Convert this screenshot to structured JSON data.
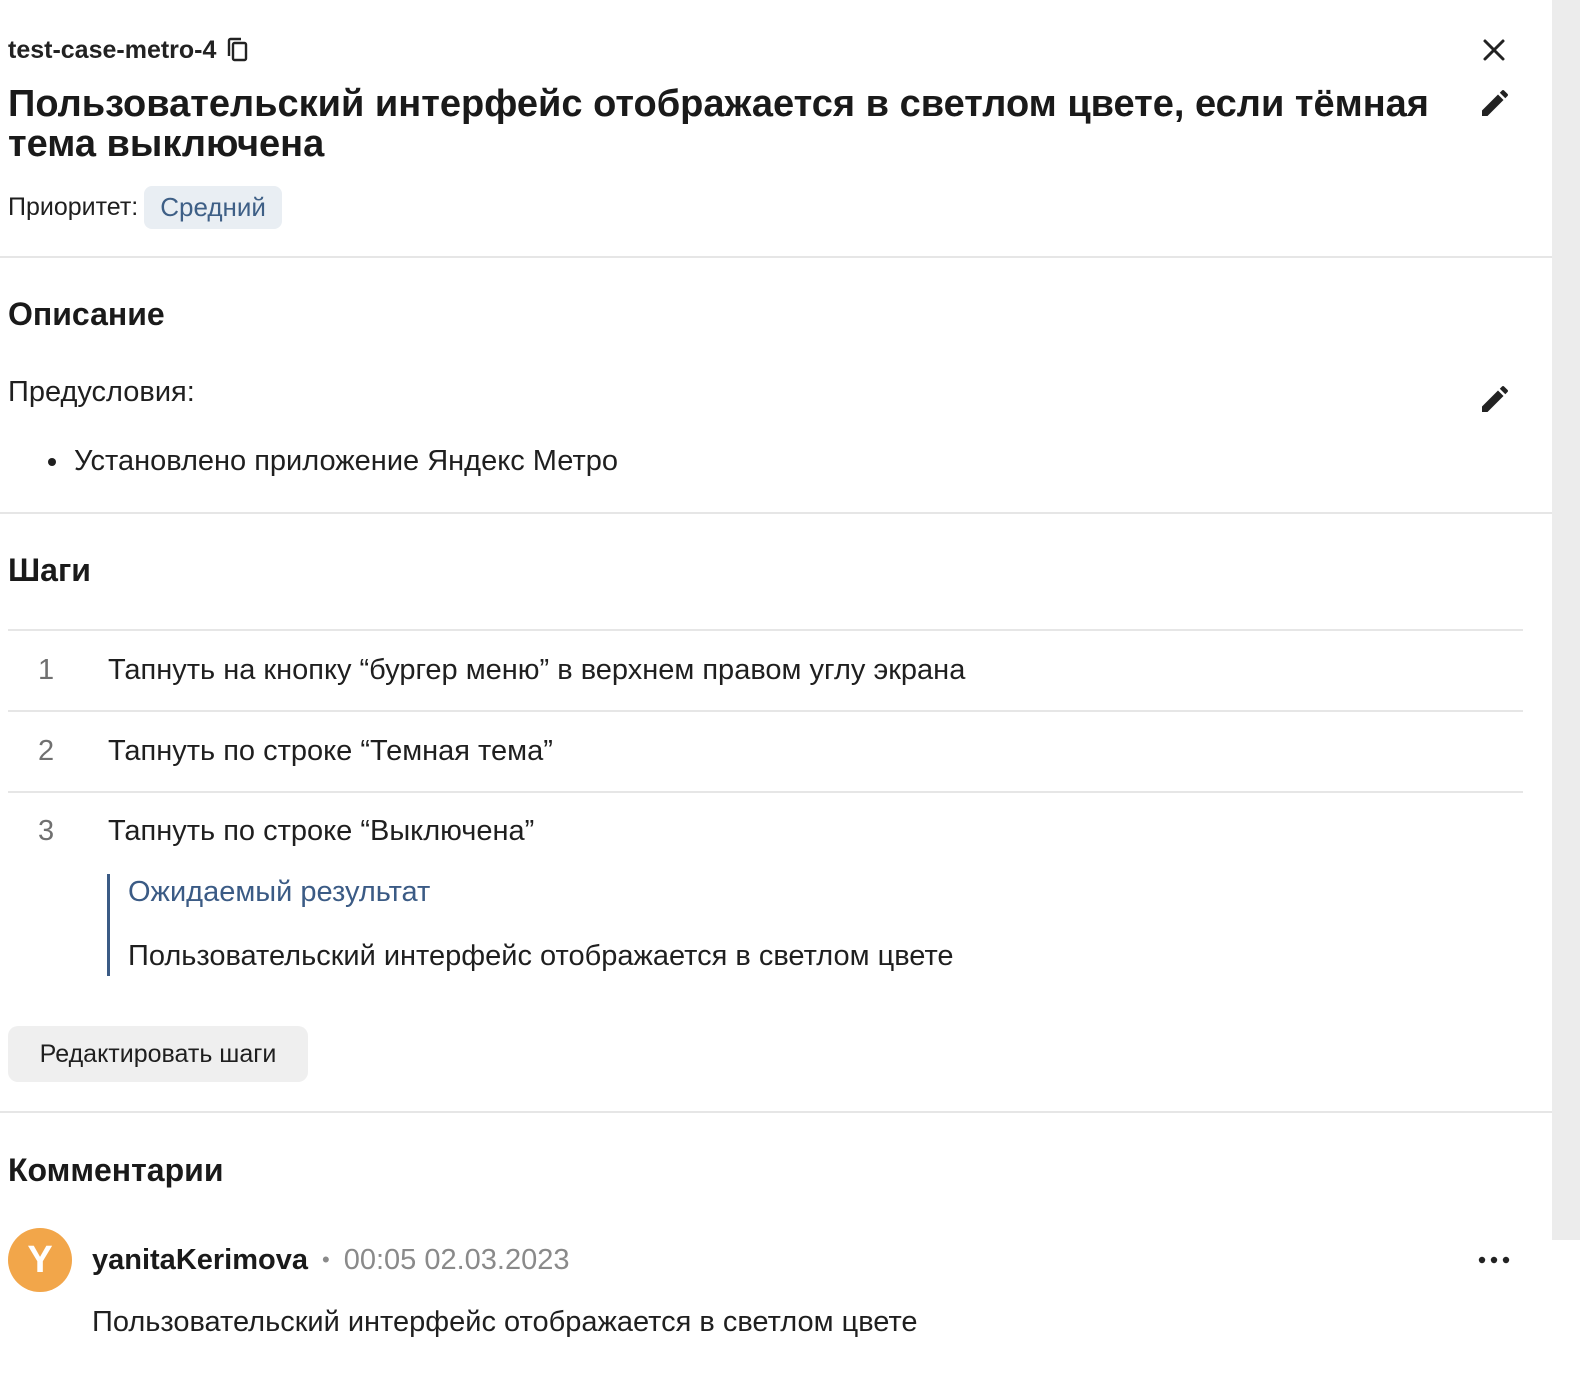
{
  "header": {
    "case_id": "test-case-metro-4",
    "title": "Пользовательский интерфейс отображается в светлом цвете, если тёмная тема выключена",
    "priority_label": "Приоритет:",
    "priority_value": "Средний"
  },
  "description": {
    "title": "Описание",
    "preconditions_label": "Предусловия:",
    "items": [
      "Установлено приложение Яндекс Метро"
    ]
  },
  "steps": {
    "title": "Шаги",
    "items": [
      {
        "number": "1",
        "text": "Тапнуть на кнопку “бургер меню” в верхнем правом углу экрана"
      },
      {
        "number": "2",
        "text": "Тапнуть по строке “Темная тема”"
      },
      {
        "number": "3",
        "text": "Тапнуть по строке “Выключена”"
      }
    ],
    "expected_title": "Ожидаемый результат",
    "expected_text": "Пользовательский интерфейс отображается в светлом цвете",
    "edit_button": "Редактировать шаги"
  },
  "comments": {
    "title": "Комментарии",
    "items": [
      {
        "avatar_letter": "Y",
        "author": "yanitaKerimova",
        "separator": "•",
        "time": "00:05 02.03.2023",
        "text": "Пользовательский интерфейс отображается в светлом цвете"
      }
    ]
  },
  "icons": {
    "copy": "copy-icon",
    "close": "close-icon",
    "edit": "pencil-icon",
    "more": "more-horizontal-icon"
  },
  "colors": {
    "accent": "#3b5b85",
    "badge_bg": "#e9eef3",
    "avatar": "#f2a64a"
  }
}
